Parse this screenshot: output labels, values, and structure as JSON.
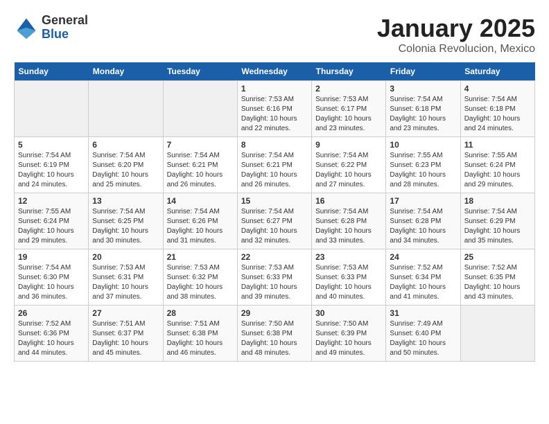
{
  "logo": {
    "general": "General",
    "blue": "Blue"
  },
  "title": "January 2025",
  "subtitle": "Colonia Revolucion, Mexico",
  "headers": [
    "Sunday",
    "Monday",
    "Tuesday",
    "Wednesday",
    "Thursday",
    "Friday",
    "Saturday"
  ],
  "weeks": [
    [
      {
        "day": "",
        "info": ""
      },
      {
        "day": "",
        "info": ""
      },
      {
        "day": "",
        "info": ""
      },
      {
        "day": "1",
        "info": "Sunrise: 7:53 AM\nSunset: 6:16 PM\nDaylight: 10 hours\nand 22 minutes."
      },
      {
        "day": "2",
        "info": "Sunrise: 7:53 AM\nSunset: 6:17 PM\nDaylight: 10 hours\nand 23 minutes."
      },
      {
        "day": "3",
        "info": "Sunrise: 7:54 AM\nSunset: 6:18 PM\nDaylight: 10 hours\nand 23 minutes."
      },
      {
        "day": "4",
        "info": "Sunrise: 7:54 AM\nSunset: 6:18 PM\nDaylight: 10 hours\nand 24 minutes."
      }
    ],
    [
      {
        "day": "5",
        "info": "Sunrise: 7:54 AM\nSunset: 6:19 PM\nDaylight: 10 hours\nand 24 minutes."
      },
      {
        "day": "6",
        "info": "Sunrise: 7:54 AM\nSunset: 6:20 PM\nDaylight: 10 hours\nand 25 minutes."
      },
      {
        "day": "7",
        "info": "Sunrise: 7:54 AM\nSunset: 6:21 PM\nDaylight: 10 hours\nand 26 minutes."
      },
      {
        "day": "8",
        "info": "Sunrise: 7:54 AM\nSunset: 6:21 PM\nDaylight: 10 hours\nand 26 minutes."
      },
      {
        "day": "9",
        "info": "Sunrise: 7:54 AM\nSunset: 6:22 PM\nDaylight: 10 hours\nand 27 minutes."
      },
      {
        "day": "10",
        "info": "Sunrise: 7:55 AM\nSunset: 6:23 PM\nDaylight: 10 hours\nand 28 minutes."
      },
      {
        "day": "11",
        "info": "Sunrise: 7:55 AM\nSunset: 6:24 PM\nDaylight: 10 hours\nand 29 minutes."
      }
    ],
    [
      {
        "day": "12",
        "info": "Sunrise: 7:55 AM\nSunset: 6:24 PM\nDaylight: 10 hours\nand 29 minutes."
      },
      {
        "day": "13",
        "info": "Sunrise: 7:54 AM\nSunset: 6:25 PM\nDaylight: 10 hours\nand 30 minutes."
      },
      {
        "day": "14",
        "info": "Sunrise: 7:54 AM\nSunset: 6:26 PM\nDaylight: 10 hours\nand 31 minutes."
      },
      {
        "day": "15",
        "info": "Sunrise: 7:54 AM\nSunset: 6:27 PM\nDaylight: 10 hours\nand 32 minutes."
      },
      {
        "day": "16",
        "info": "Sunrise: 7:54 AM\nSunset: 6:28 PM\nDaylight: 10 hours\nand 33 minutes."
      },
      {
        "day": "17",
        "info": "Sunrise: 7:54 AM\nSunset: 6:28 PM\nDaylight: 10 hours\nand 34 minutes."
      },
      {
        "day": "18",
        "info": "Sunrise: 7:54 AM\nSunset: 6:29 PM\nDaylight: 10 hours\nand 35 minutes."
      }
    ],
    [
      {
        "day": "19",
        "info": "Sunrise: 7:54 AM\nSunset: 6:30 PM\nDaylight: 10 hours\nand 36 minutes."
      },
      {
        "day": "20",
        "info": "Sunrise: 7:53 AM\nSunset: 6:31 PM\nDaylight: 10 hours\nand 37 minutes."
      },
      {
        "day": "21",
        "info": "Sunrise: 7:53 AM\nSunset: 6:32 PM\nDaylight: 10 hours\nand 38 minutes."
      },
      {
        "day": "22",
        "info": "Sunrise: 7:53 AM\nSunset: 6:33 PM\nDaylight: 10 hours\nand 39 minutes."
      },
      {
        "day": "23",
        "info": "Sunrise: 7:53 AM\nSunset: 6:33 PM\nDaylight: 10 hours\nand 40 minutes."
      },
      {
        "day": "24",
        "info": "Sunrise: 7:52 AM\nSunset: 6:34 PM\nDaylight: 10 hours\nand 41 minutes."
      },
      {
        "day": "25",
        "info": "Sunrise: 7:52 AM\nSunset: 6:35 PM\nDaylight: 10 hours\nand 43 minutes."
      }
    ],
    [
      {
        "day": "26",
        "info": "Sunrise: 7:52 AM\nSunset: 6:36 PM\nDaylight: 10 hours\nand 44 minutes."
      },
      {
        "day": "27",
        "info": "Sunrise: 7:51 AM\nSunset: 6:37 PM\nDaylight: 10 hours\nand 45 minutes."
      },
      {
        "day": "28",
        "info": "Sunrise: 7:51 AM\nSunset: 6:38 PM\nDaylight: 10 hours\nand 46 minutes."
      },
      {
        "day": "29",
        "info": "Sunrise: 7:50 AM\nSunset: 6:38 PM\nDaylight: 10 hours\nand 48 minutes."
      },
      {
        "day": "30",
        "info": "Sunrise: 7:50 AM\nSunset: 6:39 PM\nDaylight: 10 hours\nand 49 minutes."
      },
      {
        "day": "31",
        "info": "Sunrise: 7:49 AM\nSunset: 6:40 PM\nDaylight: 10 hours\nand 50 minutes."
      },
      {
        "day": "",
        "info": ""
      }
    ]
  ]
}
